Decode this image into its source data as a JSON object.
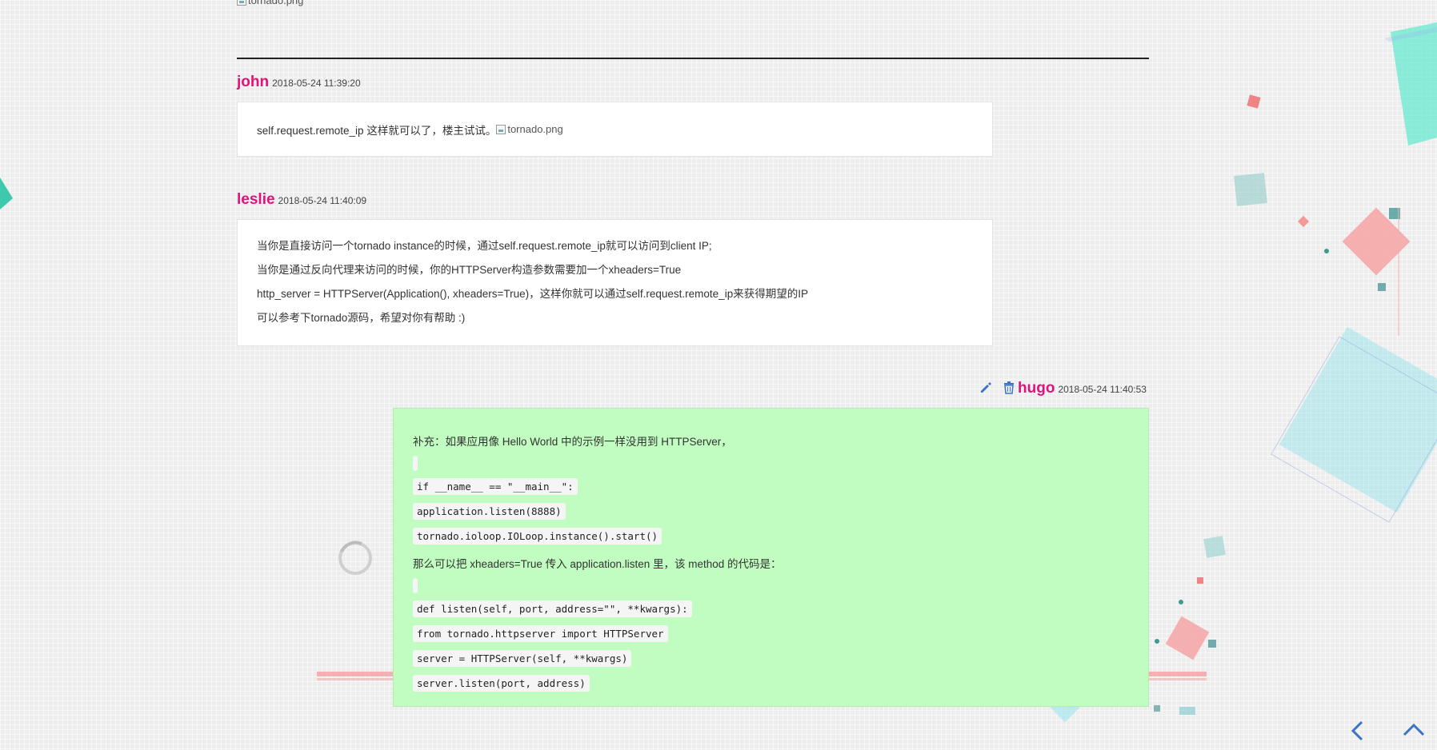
{
  "top_image": {
    "alt": "tornado.png"
  },
  "comments": [
    {
      "author": "john",
      "date": "2018-05-24 11:39:20",
      "text": "self.request.remote_ip 这样就可以了，楼主试试。",
      "image_alt": "tornado.png"
    },
    {
      "author": "leslie",
      "date": "2018-05-24 11:40:09",
      "lines": [
        "当你是直接访问一个tornado instance的时候，通过self.request.remote_ip就可以访问到client IP;",
        "当你是通过反向代理来访问的时候，你的HTTPServer构造参数需要加一个xheaders=True",
        "http_server = HTTPServer(Application(), xheaders=True)，这样你就可以通过self.request.remote_ip来获得期望的IP",
        "可以参考下tornado源码，希望对你有帮助 :)"
      ]
    }
  ],
  "own_comment": {
    "author": "hugo",
    "date": "2018-05-24 11:40:53",
    "intro": "补充：如果应用像 Hello World 中的示例一样没用到 HTTPServer，",
    "code1": [
      "if __name__ == \"__main__\":",
      "application.listen(8888)",
      "tornado.ioloop.IOLoop.instance().start()"
    ],
    "middle": "那么可以把 xheaders=True 传入 application.listen 里，该 method 的代码是：",
    "code2": [
      "def listen(self, port, address=\"\", **kwargs):",
      "from tornado.httpserver import HTTPServer",
      "server = HTTPServer(self, **kwargs)",
      "server.listen(port, address)"
    ]
  },
  "icons": {
    "edit": "pencil-icon",
    "delete": "trash-icon",
    "back": "chevron-left-icon",
    "top": "chevron-up-icon"
  },
  "colors": {
    "author": "#e3117c",
    "own_comment_bg": "#c1fcc1",
    "icon_blue": "#3a74c9"
  }
}
